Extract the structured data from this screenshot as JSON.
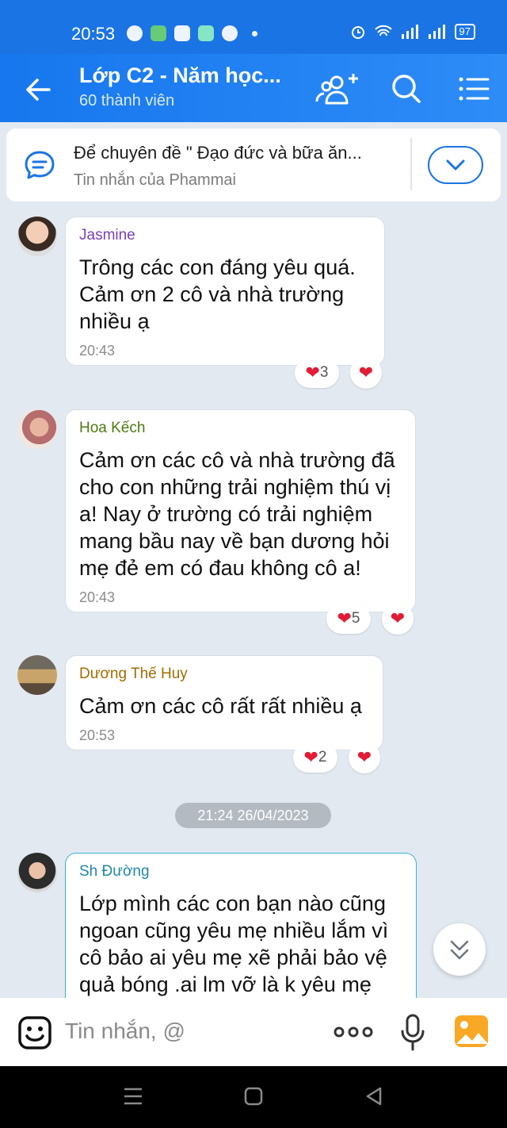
{
  "status_bar": {
    "time": "20:53",
    "battery": "97"
  },
  "header": {
    "title": "Lớp C2 - Năm học...",
    "subtitle": "60 thành viên"
  },
  "pinned": {
    "text": "Để chuyên đề \" Đạo đức và bữa ăn...",
    "sub": "Tin nhắn của Phammai"
  },
  "messages": [
    {
      "sender": "Jasmine",
      "sender_color": "#7a3fb8",
      "text": "Trông các con đáng yêu quá. Cảm ơn 2 cô và nhà trường nhiều ạ",
      "time": "20:43",
      "reaction_count": "3"
    },
    {
      "sender": "Hoa Kếch",
      "sender_color": "#4f7a12",
      "text": "Cảm ơn các cô và nhà trường đã cho con những trải nghiệm thú vị a! Nay ở trường có trải nghiệm mang bầu nay về bạn dương hỏi mẹ đẻ em có đau không cô a!",
      "time": "20:43",
      "reaction_count": "5"
    },
    {
      "sender": "Dương Thế Huy",
      "sender_color": "#a36b00",
      "text": "Cảm ơn các cô rất rất nhiều ạ",
      "time": "20:53",
      "reaction_count": "2"
    },
    {
      "sender": "Sh Đường",
      "sender_color": "#1e88a8",
      "text": "Lớp mình các con bạn nào cũng ngoan cũng yêu mẹ nhiều lắm vì cô bảo ai yêu mẹ xẽ phải bảo vệ quả bóng .ai lm vỡ là k yêu mẹ"
    }
  ],
  "date_separator": "21:24 26/04/2023",
  "input": {
    "placeholder": "Tin nhắn, @"
  },
  "icons": {
    "back": "arrow-left-icon",
    "add_member": "add-member-icon",
    "search": "search-icon",
    "menu": "list-menu-icon",
    "pin": "chat-bubble-icon",
    "expand": "chevron-down-icon",
    "emoji": "emoji-icon",
    "more": "more-dots-icon",
    "mic": "microphone-icon",
    "image": "image-icon",
    "scroll_down": "double-chevron-down-icon"
  },
  "colors": {
    "header": "#1b74e4",
    "accent": "#1b74e4",
    "heart": "#e21c36",
    "chat_bg": "#e2e9f1"
  }
}
